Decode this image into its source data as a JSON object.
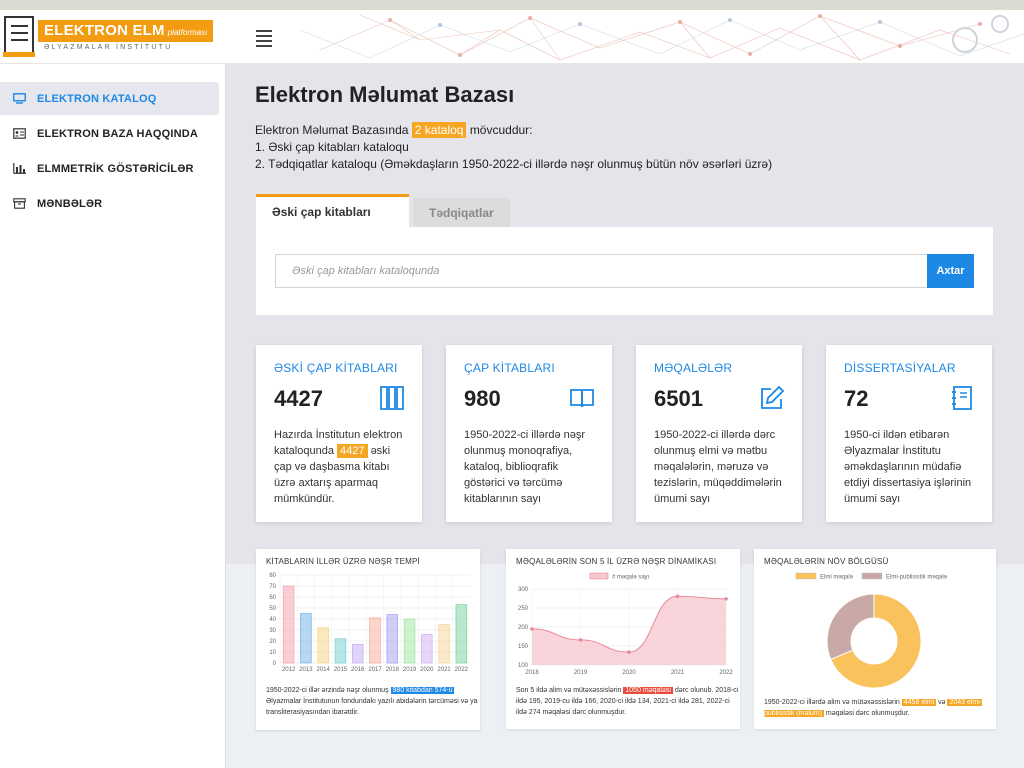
{
  "header": {
    "logo_title": "ELEKTRON ELM",
    "logo_subtitle": "platforması",
    "logo_institute": "ƏLYAZMALAR İNSTİTUTU"
  },
  "sidebar": {
    "items": [
      {
        "label": "ELEKTRON KATALOQ",
        "icon": "monitor-icon",
        "active": true
      },
      {
        "label": "ELEKTRON BAZA HAQQINDA",
        "icon": "id-card-icon",
        "active": false
      },
      {
        "label": "ELMMETRİK GÖSTƏRİCİLƏR",
        "icon": "bar-chart-icon",
        "active": false
      },
      {
        "label": "MƏNBƏLƏR",
        "icon": "archive-icon",
        "active": false
      }
    ]
  },
  "main": {
    "title": "Elektron Məlumat Bazası",
    "intro_prefix": "Elektron Məlumat Bazasında",
    "intro_highlight": "2 kataloq",
    "intro_suffix": "mövcuddur:",
    "list_item_1": "1. Əski çap kitabları kataloqu",
    "list_item_2": "2. Tədqiqatlar kataloqu (Əməkdaşların 1950-2022-ci illərdə nəşr olunmuş bütün növ əsərləri üzrə)"
  },
  "tabs": [
    {
      "label": "Əski çap kitabları",
      "active": true
    },
    {
      "label": "Tədqiqatlar",
      "active": false
    }
  ],
  "search": {
    "placeholder": "Əski çap kitabları kataloqunda",
    "value": "",
    "button_label": "Axtar"
  },
  "cards": [
    {
      "title": "ƏSKİ ÇAP KİTABLARI",
      "number": "4427",
      "icon": "columns-icon",
      "desc_prefix": "Hazırda İnstitutun elektron kataloqunda",
      "desc_highlight": "4427",
      "desc_suffix": "əski çap və daşbasma kitabı üzrə axtarış aparmaq mümkündür."
    },
    {
      "title": "ÇAP KİTABLARI",
      "number": "980",
      "icon": "open-book-icon",
      "desc": "1950-2022-ci illərdə nəşr olunmuş monoqrafiya, kataloq, biblioqrafik göstərici və tərcümə kitablarının sayı"
    },
    {
      "title": "MƏQALƏLƏR",
      "number": "6501",
      "icon": "pencil-edit-icon",
      "desc": "1950-2022-ci illərdə dərc olunmuş elmi və mətbu məqalələrin, məruzə və tezislərin, müqəddimələrin ümumi sayı"
    },
    {
      "title": "DİSSERTASİYALAR",
      "number": "72",
      "icon": "notebook-icon",
      "desc": "1950-ci ildən etibarən Əlyazmalar İnstitutu əməkdaşlarının müdafiə etdiyi dissertasiya işlərinin ümumi sayı"
    }
  ],
  "colors": {
    "accent_orange": "#f39c12",
    "accent_blue": "#1e88e5"
  },
  "chart_data": [
    {
      "type": "bar",
      "title": "KİTABLARIN İLLƏR ÜZRƏ NƏŞR TEMPİ",
      "categories": [
        "2012",
        "2013",
        "2014",
        "2015",
        "2016",
        "2017",
        "2018",
        "2019",
        "2020",
        "2021",
        "2022"
      ],
      "values": [
        70,
        45,
        32,
        22,
        17,
        41,
        44,
        40,
        26,
        35,
        53
      ],
      "colors": [
        "#f4a6b4",
        "#7cb8ea",
        "#f7d68a",
        "#7dd3d3",
        "#c7b0f4",
        "#f7b0a0",
        "#a7a7f7",
        "#a6e6a6",
        "#d8b4f4",
        "#f6d9a0",
        "#7fd6a8"
      ],
      "ylim": [
        0,
        80
      ],
      "yticks": [
        0,
        10,
        20,
        30,
        40,
        50,
        60,
        70,
        80
      ],
      "grid": true,
      "desc_prefix": "1950-2022-ci illər ərzində nəşr olunmuş",
      "desc_highlight": "980 kitabdan 574-ü",
      "desc_suffix": "Əlyazmalar İnstitutunun fondundakı yazılı abidələrin tərcüməsi və ya transliterasiyasından ibarətdir."
    },
    {
      "type": "area",
      "title": "MƏQALƏLƏRİN SON 5 İL ÜZRƏ NƏŞR DİNAMİKASI",
      "x": [
        "2018",
        "2019",
        "2020",
        "2021",
        "2022"
      ],
      "series": [
        {
          "name": "# məqalə sayı",
          "values": [
            195,
            166,
            134,
            281,
            274
          ]
        }
      ],
      "ylim": [
        100,
        300
      ],
      "yticks": [
        100,
        150,
        200,
        250,
        300
      ],
      "grid": true,
      "legend": "top-center",
      "desc_prefix": "Son 5 ildə alim və mütəxəssislərin",
      "desc_highlight": "1050 məqaləsi",
      "desc_suffix": "dərc olunub. 2018-ci ildə 195, 2019-cu ildə 166, 2020-ci ildə 134, 2021-ci ildə 281, 2022-ci ildə 274 məqaləsi dərc olunmuşdur."
    },
    {
      "type": "pie",
      "title": "MƏQALƏLƏRİN NÖV BÖLGÜSÜ",
      "categories": [
        "Elmi məqalə",
        "Elmi-publisistik məqalə"
      ],
      "values": [
        4458,
        2043
      ],
      "colors": [
        "#f9c25d",
        "#c9a9a6"
      ],
      "legend": "top-center",
      "desc_prefix": "1950-2022-ci illərdə alim və mütəxəssislərin",
      "desc_highlight_1": "4458 elmi",
      "desc_mid": "və",
      "desc_highlight_2": "2043 elmi-publisistik (məlum)",
      "desc_suffix": "məqaləsi dərc olunmuşdur."
    }
  ]
}
